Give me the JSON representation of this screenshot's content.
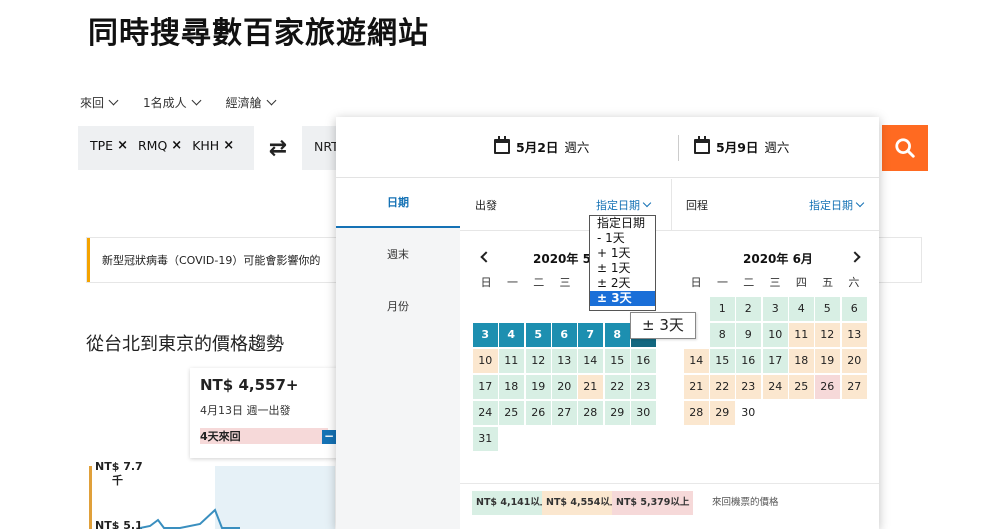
{
  "page": {
    "title": "同時搜尋數百家旅遊網站",
    "filters": [
      "來回",
      "1名成人",
      "經濟艙"
    ],
    "origins": [
      "TPE",
      "RMQ",
      "KHH"
    ],
    "destination": "NRT",
    "covid_notice": "新型冠狀病毒（COVID-19）可能會影響你的",
    "trend_title": "從台北到東京的價格趨勢",
    "price_card": {
      "price": "NT$ 4,557+",
      "date": "4月13日 週一出發",
      "duration": "4天來回"
    },
    "axis_labels": [
      "NT$ 7.7",
      "千",
      "NT$ 5.1"
    ]
  },
  "picker": {
    "depart_date": "5月2日",
    "depart_day": "週六",
    "return_date": "5月9日",
    "return_day": "週六",
    "tabs": [
      "日期",
      "週末",
      "月份"
    ],
    "depart_label": "出發",
    "depart_select": "指定日期",
    "return_label": "回程",
    "return_select": "指定日期",
    "dropdown_options": [
      "指定日期",
      "- 1天",
      "+ 1天",
      "± 1天",
      "± 2天",
      "± 3天"
    ],
    "dropdown_selected": "± 3天",
    "tooltip": "± 3天",
    "month_left": "2020年 5月",
    "month_right": "2020年 6月",
    "weekdays": [
      "日",
      "一",
      "二",
      "三",
      "四",
      "五",
      "六"
    ],
    "legend": [
      {
        "text": "NT$ 4,141以上",
        "color": "#d8efe4"
      },
      {
        "text": "NT$ 4,554以上",
        "color": "#fbe7cf"
      },
      {
        "text": "NT$ 5,379以上",
        "color": "#f6d9d9"
      }
    ],
    "legend_note": "來回機票的價格",
    "colors": {
      "accent": "#1572b5",
      "search_button": "#ff6a21",
      "selected_cell": "#1d8fb0"
    }
  }
}
